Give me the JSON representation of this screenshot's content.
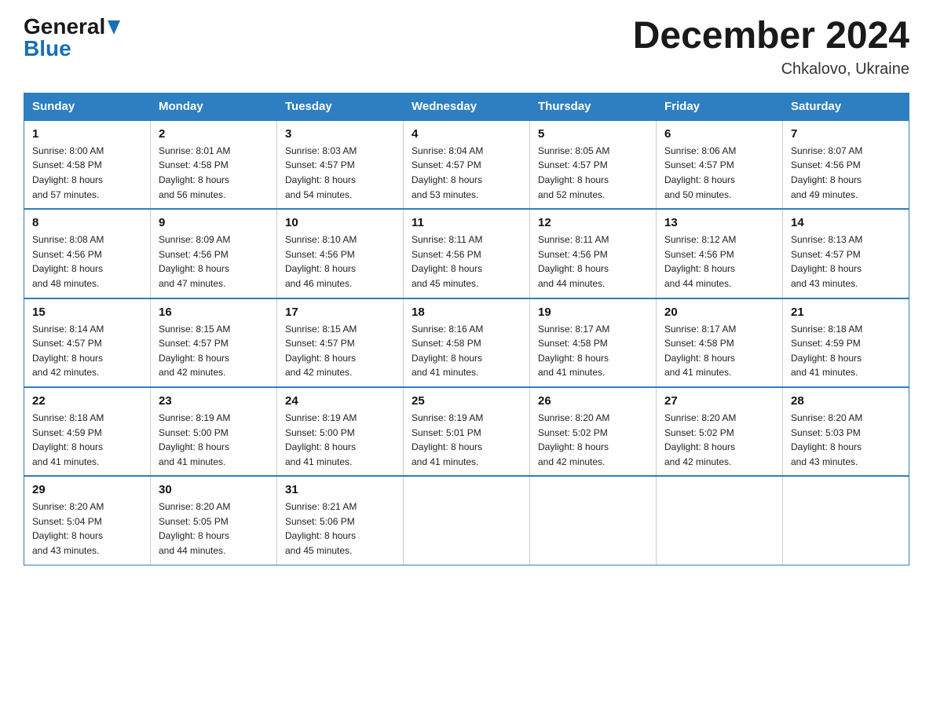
{
  "logo": {
    "general": "General",
    "blue": "Blue"
  },
  "title": "December 2024",
  "location": "Chkalovo, Ukraine",
  "days_header": [
    "Sunday",
    "Monday",
    "Tuesday",
    "Wednesday",
    "Thursday",
    "Friday",
    "Saturday"
  ],
  "weeks": [
    [
      {
        "num": "1",
        "sunrise": "8:00 AM",
        "sunset": "4:58 PM",
        "daylight": "8 hours and 57 minutes."
      },
      {
        "num": "2",
        "sunrise": "8:01 AM",
        "sunset": "4:58 PM",
        "daylight": "8 hours and 56 minutes."
      },
      {
        "num": "3",
        "sunrise": "8:03 AM",
        "sunset": "4:57 PM",
        "daylight": "8 hours and 54 minutes."
      },
      {
        "num": "4",
        "sunrise": "8:04 AM",
        "sunset": "4:57 PM",
        "daylight": "8 hours and 53 minutes."
      },
      {
        "num": "5",
        "sunrise": "8:05 AM",
        "sunset": "4:57 PM",
        "daylight": "8 hours and 52 minutes."
      },
      {
        "num": "6",
        "sunrise": "8:06 AM",
        "sunset": "4:57 PM",
        "daylight": "8 hours and 50 minutes."
      },
      {
        "num": "7",
        "sunrise": "8:07 AM",
        "sunset": "4:56 PM",
        "daylight": "8 hours and 49 minutes."
      }
    ],
    [
      {
        "num": "8",
        "sunrise": "8:08 AM",
        "sunset": "4:56 PM",
        "daylight": "8 hours and 48 minutes."
      },
      {
        "num": "9",
        "sunrise": "8:09 AM",
        "sunset": "4:56 PM",
        "daylight": "8 hours and 47 minutes."
      },
      {
        "num": "10",
        "sunrise": "8:10 AM",
        "sunset": "4:56 PM",
        "daylight": "8 hours and 46 minutes."
      },
      {
        "num": "11",
        "sunrise": "8:11 AM",
        "sunset": "4:56 PM",
        "daylight": "8 hours and 45 minutes."
      },
      {
        "num": "12",
        "sunrise": "8:11 AM",
        "sunset": "4:56 PM",
        "daylight": "8 hours and 44 minutes."
      },
      {
        "num": "13",
        "sunrise": "8:12 AM",
        "sunset": "4:56 PM",
        "daylight": "8 hours and 44 minutes."
      },
      {
        "num": "14",
        "sunrise": "8:13 AM",
        "sunset": "4:57 PM",
        "daylight": "8 hours and 43 minutes."
      }
    ],
    [
      {
        "num": "15",
        "sunrise": "8:14 AM",
        "sunset": "4:57 PM",
        "daylight": "8 hours and 42 minutes."
      },
      {
        "num": "16",
        "sunrise": "8:15 AM",
        "sunset": "4:57 PM",
        "daylight": "8 hours and 42 minutes."
      },
      {
        "num": "17",
        "sunrise": "8:15 AM",
        "sunset": "4:57 PM",
        "daylight": "8 hours and 42 minutes."
      },
      {
        "num": "18",
        "sunrise": "8:16 AM",
        "sunset": "4:58 PM",
        "daylight": "8 hours and 41 minutes."
      },
      {
        "num": "19",
        "sunrise": "8:17 AM",
        "sunset": "4:58 PM",
        "daylight": "8 hours and 41 minutes."
      },
      {
        "num": "20",
        "sunrise": "8:17 AM",
        "sunset": "4:58 PM",
        "daylight": "8 hours and 41 minutes."
      },
      {
        "num": "21",
        "sunrise": "8:18 AM",
        "sunset": "4:59 PM",
        "daylight": "8 hours and 41 minutes."
      }
    ],
    [
      {
        "num": "22",
        "sunrise": "8:18 AM",
        "sunset": "4:59 PM",
        "daylight": "8 hours and 41 minutes."
      },
      {
        "num": "23",
        "sunrise": "8:19 AM",
        "sunset": "5:00 PM",
        "daylight": "8 hours and 41 minutes."
      },
      {
        "num": "24",
        "sunrise": "8:19 AM",
        "sunset": "5:00 PM",
        "daylight": "8 hours and 41 minutes."
      },
      {
        "num": "25",
        "sunrise": "8:19 AM",
        "sunset": "5:01 PM",
        "daylight": "8 hours and 41 minutes."
      },
      {
        "num": "26",
        "sunrise": "8:20 AM",
        "sunset": "5:02 PM",
        "daylight": "8 hours and 42 minutes."
      },
      {
        "num": "27",
        "sunrise": "8:20 AM",
        "sunset": "5:02 PM",
        "daylight": "8 hours and 42 minutes."
      },
      {
        "num": "28",
        "sunrise": "8:20 AM",
        "sunset": "5:03 PM",
        "daylight": "8 hours and 43 minutes."
      }
    ],
    [
      {
        "num": "29",
        "sunrise": "8:20 AM",
        "sunset": "5:04 PM",
        "daylight": "8 hours and 43 minutes."
      },
      {
        "num": "30",
        "sunrise": "8:20 AM",
        "sunset": "5:05 PM",
        "daylight": "8 hours and 44 minutes."
      },
      {
        "num": "31",
        "sunrise": "8:21 AM",
        "sunset": "5:06 PM",
        "daylight": "8 hours and 45 minutes."
      },
      null,
      null,
      null,
      null
    ]
  ],
  "labels": {
    "sunrise": "Sunrise:",
    "sunset": "Sunset:",
    "daylight": "Daylight:"
  }
}
